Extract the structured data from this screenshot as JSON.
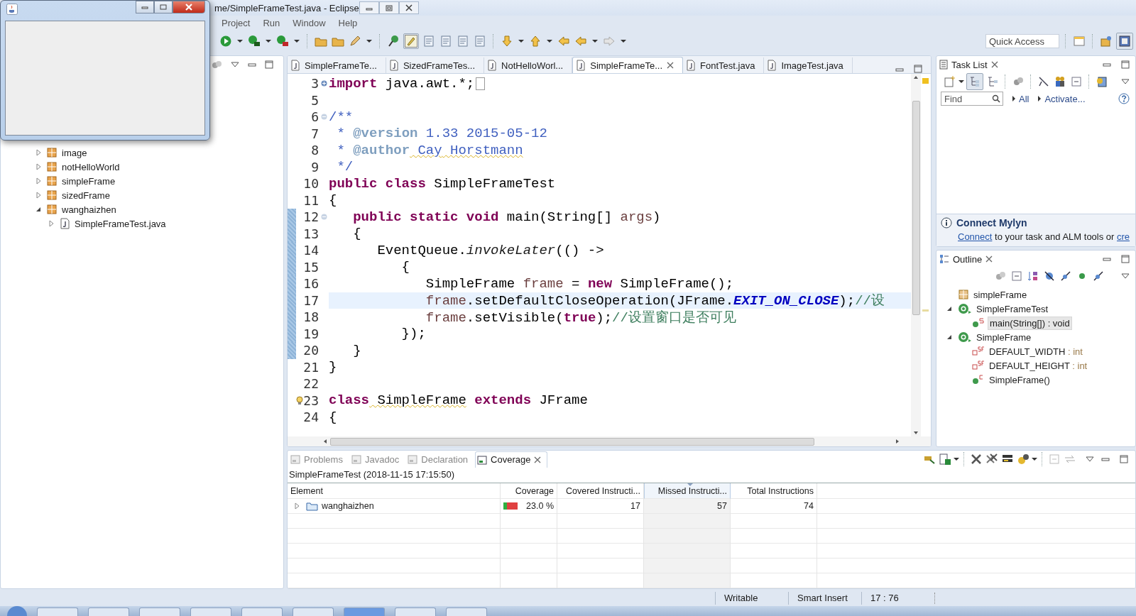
{
  "window": {
    "title": "me/SimpleFrameTest.java - Eclipse"
  },
  "menu": [
    "Project",
    "Run",
    "Window",
    "Help"
  ],
  "quick_access": {
    "placeholder": "Quick Access"
  },
  "package_explorer": {
    "items": [
      {
        "label": "image",
        "kind": "package",
        "expanded": false
      },
      {
        "label": "notHelloWorld",
        "kind": "package",
        "expanded": false
      },
      {
        "label": "simpleFrame",
        "kind": "package",
        "expanded": false
      },
      {
        "label": "sizedFrame",
        "kind": "package",
        "expanded": false
      },
      {
        "label": "wanghaizhen",
        "kind": "package",
        "expanded": true,
        "children": [
          {
            "label": "SimpleFrameTest.java",
            "kind": "file",
            "expanded": false
          }
        ]
      }
    ]
  },
  "editor": {
    "tabs": [
      {
        "label": "SimpleFrameTe...",
        "selected": false
      },
      {
        "label": "SizedFrameTes...",
        "selected": false
      },
      {
        "label": "NotHelloWorl...",
        "selected": false
      },
      {
        "label": "SimpleFrameTe...",
        "selected": true
      },
      {
        "label": "FontTest.java",
        "selected": false
      },
      {
        "label": "ImageTest.java",
        "selected": false
      }
    ],
    "lines": [
      {
        "number": "3",
        "foldable": true,
        "folded": true,
        "changed": false,
        "current": false,
        "warning": false,
        "tokens": [
          {
            "text": "import",
            "kind": "kw"
          },
          {
            "text": " java.awt.*;",
            "kind": "plain"
          }
        ]
      },
      {
        "number": "5",
        "foldable": false,
        "changed": false,
        "current": false,
        "warning": false
      },
      {
        "number": "6",
        "foldable": true,
        "folded": false,
        "changed": false,
        "current": false,
        "warning": false,
        "tokens": [
          {
            "text": "/**",
            "kind": "jd"
          }
        ]
      },
      {
        "number": "7",
        "foldable": false,
        "changed": false,
        "current": false,
        "warning": false,
        "tokens": [
          {
            "text": " * ",
            "kind": "jd"
          },
          {
            "text": "@version",
            "kind": "tag"
          },
          {
            "text": " 1.33 2015-05-12",
            "kind": "jd"
          }
        ]
      },
      {
        "number": "8",
        "foldable": false,
        "changed": false,
        "current": false,
        "warning": false,
        "tokens": [
          {
            "text": " * ",
            "kind": "jd"
          },
          {
            "text": "@author",
            "kind": "tag"
          },
          {
            "text": " Cay",
            "kind": "jd",
            "squiggle": true
          },
          {
            "text": " Horstmann",
            "kind": "jd",
            "squiggle": true
          }
        ]
      },
      {
        "number": "9",
        "foldable": false,
        "changed": false,
        "current": false,
        "warning": false,
        "tokens": [
          {
            "text": " */",
            "kind": "jd"
          }
        ]
      },
      {
        "number": "10",
        "foldable": false,
        "changed": false,
        "current": false,
        "warning": false,
        "tokens": [
          {
            "text": "public class",
            "kind": "kw"
          },
          {
            "text": " SimpleFrameTest",
            "kind": "plain"
          }
        ]
      },
      {
        "number": "11",
        "foldable": false,
        "changed": false,
        "current": false,
        "warning": false,
        "tokens": [
          {
            "text": "{",
            "kind": "plain"
          }
        ]
      },
      {
        "number": "12",
        "foldable": true,
        "folded": false,
        "changed": true,
        "current": false,
        "warning": false,
        "tokens": [
          {
            "text": "   public static void",
            "kind": "kw"
          },
          {
            "text": " main(String[] ",
            "kind": "plain"
          },
          {
            "text": "args",
            "kind": "var"
          },
          {
            "text": ")",
            "kind": "plain"
          }
        ]
      },
      {
        "number": "13",
        "foldable": false,
        "changed": true,
        "current": false,
        "warning": false,
        "tokens": [
          {
            "text": "   {",
            "kind": "plain"
          }
        ]
      },
      {
        "number": "14",
        "foldable": false,
        "changed": true,
        "current": false,
        "warning": false,
        "tokens": [
          {
            "text": "      EventQueue.",
            "kind": "plain"
          },
          {
            "text": "invokeLater",
            "kind": "sm"
          },
          {
            "text": "(() ->",
            "kind": "plain"
          }
        ]
      },
      {
        "number": "15",
        "foldable": false,
        "changed": true,
        "current": false,
        "warning": false,
        "tokens": [
          {
            "text": "         {",
            "kind": "plain"
          }
        ]
      },
      {
        "number": "16",
        "foldable": false,
        "changed": true,
        "current": false,
        "warning": false,
        "tokens": [
          {
            "text": "            SimpleFrame ",
            "kind": "plain"
          },
          {
            "text": "frame",
            "kind": "var"
          },
          {
            "text": " = ",
            "kind": "plain"
          },
          {
            "text": "new",
            "kind": "kw"
          },
          {
            "text": " SimpleFrame();",
            "kind": "plain"
          }
        ]
      },
      {
        "number": "17",
        "foldable": false,
        "changed": true,
        "current": true,
        "warning": false,
        "tokens": [
          {
            "text": "            frame",
            "kind": "var"
          },
          {
            "text": ".setDefaultCloseOperation(JFrame.",
            "kind": "plain"
          },
          {
            "text": "EXIT_ON_CLOSE",
            "kind": "const"
          },
          {
            "text": ");",
            "kind": "plain"
          },
          {
            "text": "//设",
            "kind": "cm"
          }
        ]
      },
      {
        "number": "18",
        "foldable": false,
        "changed": true,
        "current": false,
        "warning": false,
        "tokens": [
          {
            "text": "            frame",
            "kind": "var"
          },
          {
            "text": ".setVisible(",
            "kind": "plain"
          },
          {
            "text": "true",
            "kind": "kw"
          },
          {
            "text": ");",
            "kind": "plain"
          },
          {
            "text": "//设置窗口是否可见",
            "kind": "cm"
          }
        ]
      },
      {
        "number": "19",
        "foldable": false,
        "changed": true,
        "current": false,
        "warning": false,
        "tokens": [
          {
            "text": "         });",
            "kind": "plain"
          }
        ]
      },
      {
        "number": "20",
        "foldable": false,
        "changed": true,
        "current": false,
        "warning": false,
        "tokens": [
          {
            "text": "   }",
            "kind": "plain"
          }
        ]
      },
      {
        "number": "21",
        "foldable": false,
        "changed": false,
        "current": false,
        "warning": false,
        "tokens": [
          {
            "text": "}",
            "kind": "plain"
          }
        ]
      },
      {
        "number": "22",
        "foldable": false,
        "changed": false,
        "current": false,
        "warning": false
      },
      {
        "number": "23",
        "foldable": false,
        "changed": false,
        "current": false,
        "warning": true,
        "tokens": [
          {
            "text": "class",
            "kind": "kw"
          },
          {
            "text": " SimpleFrame",
            "kind": "plain",
            "squiggle": true
          },
          {
            "text": " extends",
            "kind": "kw"
          },
          {
            "text": " JFrame",
            "kind": "plain"
          }
        ]
      },
      {
        "number": "24",
        "foldable": false,
        "changed": false,
        "current": false,
        "warning": false,
        "tokens": [
          {
            "text": "{",
            "kind": "plain"
          }
        ]
      }
    ]
  },
  "task_list": {
    "title": "Task List",
    "find": {
      "placeholder": "Find"
    },
    "filters": [
      "All",
      "Activate..."
    ]
  },
  "mylyn": {
    "heading": "Connect Mylyn",
    "link": "Connect",
    "text": " to your task and ALM tools or ",
    "link_2": "cre"
  },
  "outline": {
    "title": "Outline",
    "items": [
      {
        "label": "simpleFrame",
        "kind": "package",
        "selected": false
      },
      {
        "label": "SimpleFrameTest",
        "kind": "class",
        "expanded": true,
        "selected": false,
        "children": [
          {
            "label": "main(String[]) : void",
            "kind": "method",
            "selected": true
          }
        ]
      },
      {
        "label": "SimpleFrame",
        "kind": "class",
        "expanded": true,
        "selected": false,
        "children": [
          {
            "label": "DEFAULT_WIDTH",
            "type": " : int",
            "kind": "field",
            "selected": false
          },
          {
            "label": "DEFAULT_HEIGHT",
            "type": " : int",
            "kind": "field",
            "selected": false
          },
          {
            "label": "SimpleFrame()",
            "kind": "constructor",
            "selected": false
          }
        ]
      }
    ]
  },
  "bottom_tabs": [
    {
      "label": "Problems",
      "selected": false
    },
    {
      "label": "Javadoc",
      "selected": false
    },
    {
      "label": "Declaration",
      "selected": false
    },
    {
      "label": "Coverage",
      "selected": true
    }
  ],
  "coverage": {
    "session": "SimpleFrameTest (2018-11-15 17:15:50)",
    "columns": [
      {
        "label": "Element",
        "sorted": false
      },
      {
        "label": "Coverage",
        "sorted": false
      },
      {
        "label": "Covered Instructi...",
        "sorted": false
      },
      {
        "label": "Missed Instructi...",
        "sorted": true
      },
      {
        "label": "Total Instructions",
        "sorted": false
      }
    ],
    "rows": [
      {
        "element": "wanghaizhen",
        "expanded": false,
        "coverage": "23.0 %",
        "level": 0.23,
        "covered": "17",
        "missed": "57",
        "total": "74"
      }
    ]
  },
  "status_bar": [
    "Writable",
    "Smart Insert",
    "17 : 76"
  ]
}
